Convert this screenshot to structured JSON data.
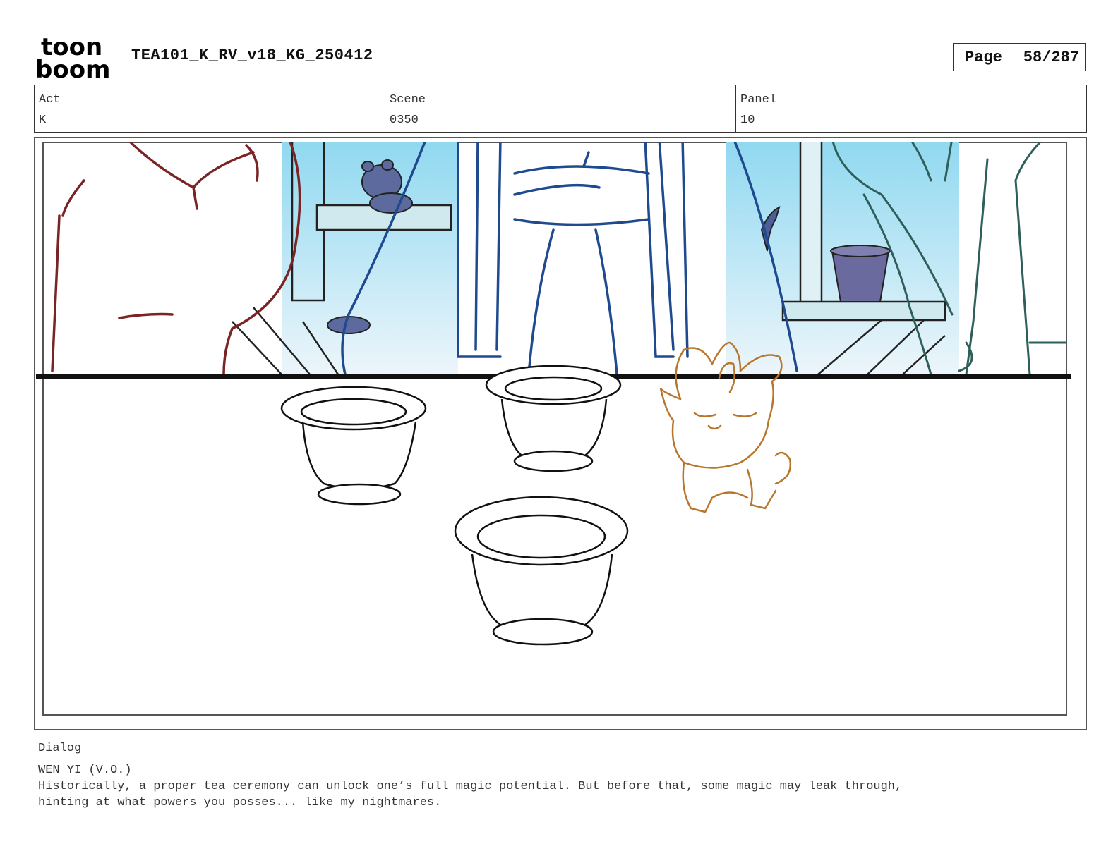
{
  "header": {
    "logo_top": "toon",
    "logo_bottom": "boom",
    "title": "TEA101_K_RV_v18_KG_250412",
    "page_label": "Page",
    "page_number": "58/287"
  },
  "meta": {
    "act_label": "Act",
    "act_value": "K",
    "scene_label": "Scene",
    "scene_value": "0350",
    "panel_label": "Panel",
    "panel_value": "10"
  },
  "colors": {
    "left_character": "#7a2424",
    "center_character": "#1f4a8f",
    "right_character": "#2f5f5a",
    "creature": "#b8762c",
    "window_sky": "#8fd8f0",
    "cups": "#111111"
  },
  "dialog": {
    "label": "Dialog",
    "speaker": "WEN YI (V.O.)",
    "text": "Historically, a proper tea ceremony can unlock one’s full magic potential. But before that, some magic may leak through,\nhinting at what powers you posses... like my nightmares."
  }
}
